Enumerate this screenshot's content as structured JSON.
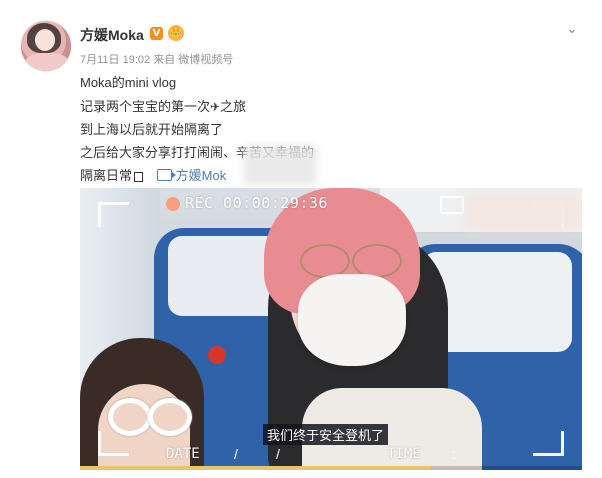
{
  "post": {
    "author": "方媛Moka",
    "verified_badge": "V",
    "member_badge": "👑",
    "timestamp": "7月11日 19:02",
    "source": "来自 微博视频号",
    "lines": [
      "Moka的mini vlog",
      "记录两个宝宝的第一次",
      "之旅",
      "到上海以后就开始隔离了",
      "之后给大家分享打打闹闹、辛苦又幸福的",
      "隔离日常"
    ],
    "plane_glyph": "✈",
    "video_link": "方媛Mok"
  },
  "video": {
    "rec_label": "REC",
    "rec_time": "00:00:29:36",
    "subtitle": "我们终于安全登机了",
    "date_label": "DATE",
    "time_label": "TIME",
    "slash": "/",
    "colon": ":",
    "progress": 0.7
  },
  "icons": {
    "menu": "chevron-down-icon",
    "video": "video-icon",
    "camera": "camera-icon"
  },
  "colors": {
    "link": "#507daf",
    "badge": "#f78e1e",
    "meta": "#939393"
  }
}
